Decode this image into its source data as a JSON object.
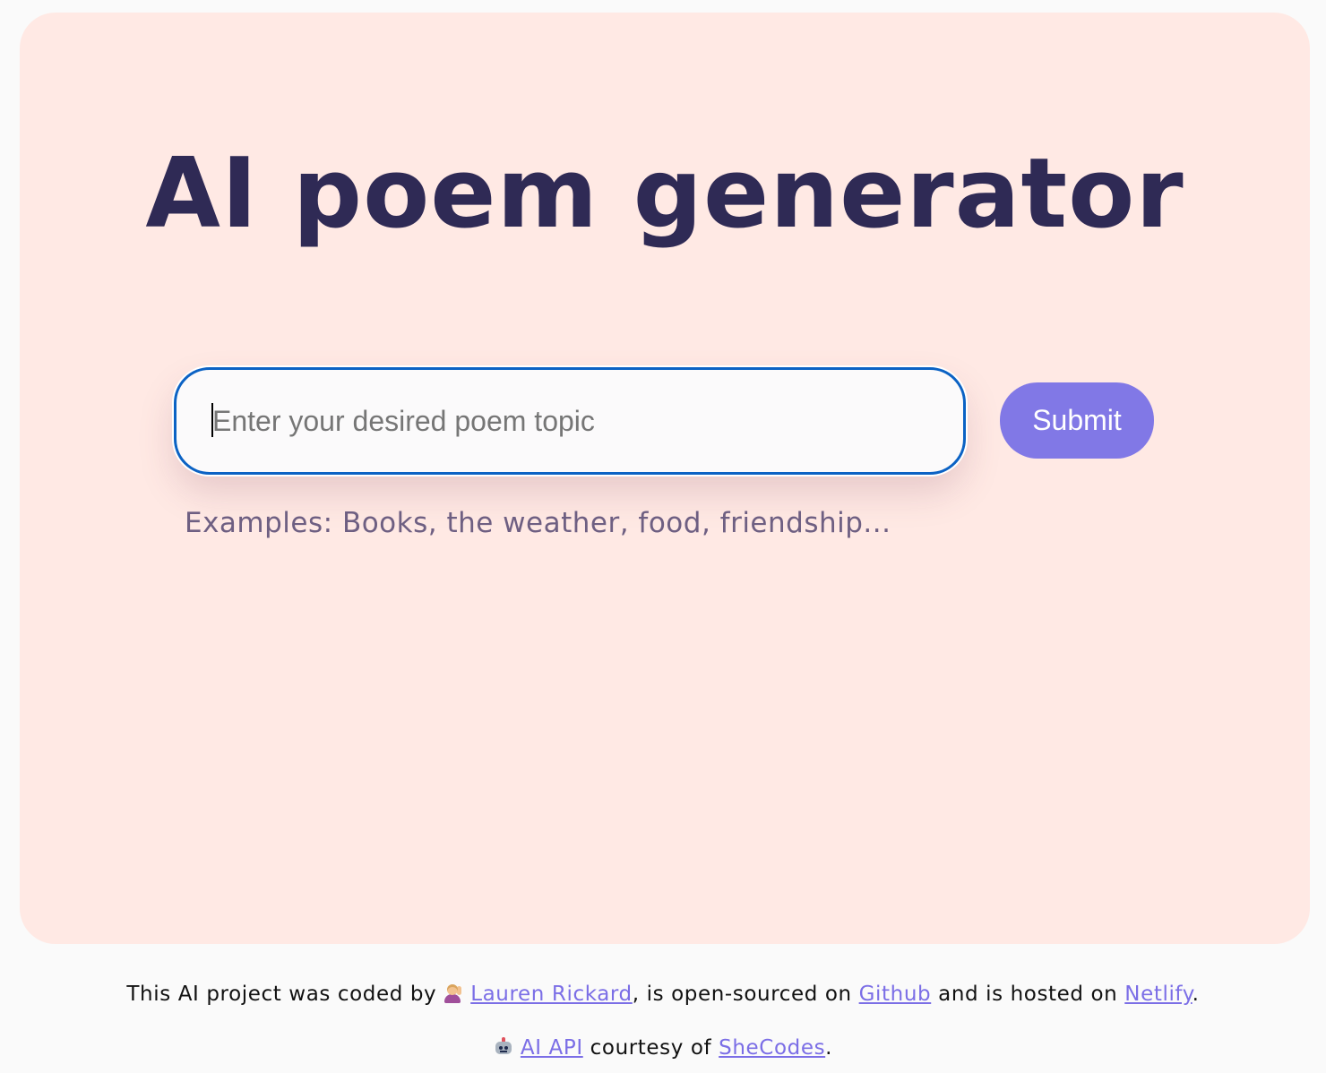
{
  "page": {
    "title": "AI poem generator"
  },
  "form": {
    "input_placeholder": "Enter your desired poem topic",
    "input_value": "",
    "submit_label": "Submit",
    "hint": "Examples: Books, the weather, food, friendship..."
  },
  "footer": {
    "line1": {
      "prefix": "This AI project was coded by",
      "author_icon": "woman-raising-hand-icon",
      "author": "Lauren Rickard",
      "middle": ", is open-sourced on ",
      "github": "Github",
      "middle2": " and is hosted on ",
      "netlify": "Netlify",
      "suffix": "."
    },
    "line2": {
      "icon": "robot-icon",
      "api": "AI API",
      "middle": " courtesy of ",
      "shecodes": "SheCodes",
      "suffix": "."
    }
  },
  "colors": {
    "page_background": "#fafafa",
    "card_background": "#ffe9e4",
    "title_color": "#2f2a55",
    "input_border": "#0b62c4",
    "button_background": "#8178e6",
    "hint_color": "#6e5f82",
    "link_color": "#7b6ee6"
  }
}
